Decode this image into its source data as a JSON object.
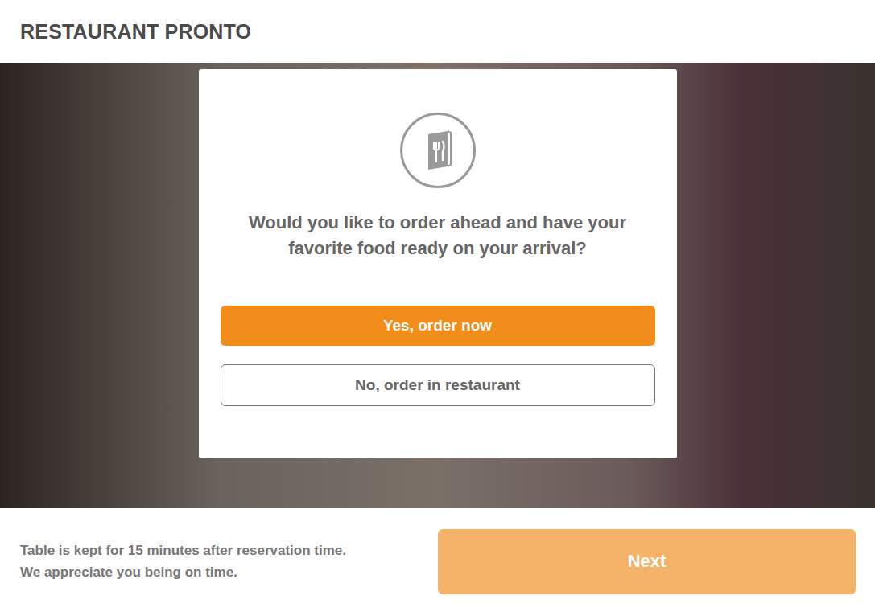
{
  "header": {
    "title": "RESTAURANT PRONTO"
  },
  "dialog": {
    "question": "Would you like to order ahead and have your favorite food ready on your arrival?",
    "buttons": [
      {
        "label": "Yes, order now",
        "kind": "primary"
      },
      {
        "label": "No, order in restaurant",
        "kind": "secondary"
      }
    ]
  },
  "footer": {
    "notice": [
      "Table is kept for 15 minutes after reservation time.",
      "We appreciate you being on time."
    ],
    "next": {
      "label": "Next",
      "disabled": true
    }
  }
}
